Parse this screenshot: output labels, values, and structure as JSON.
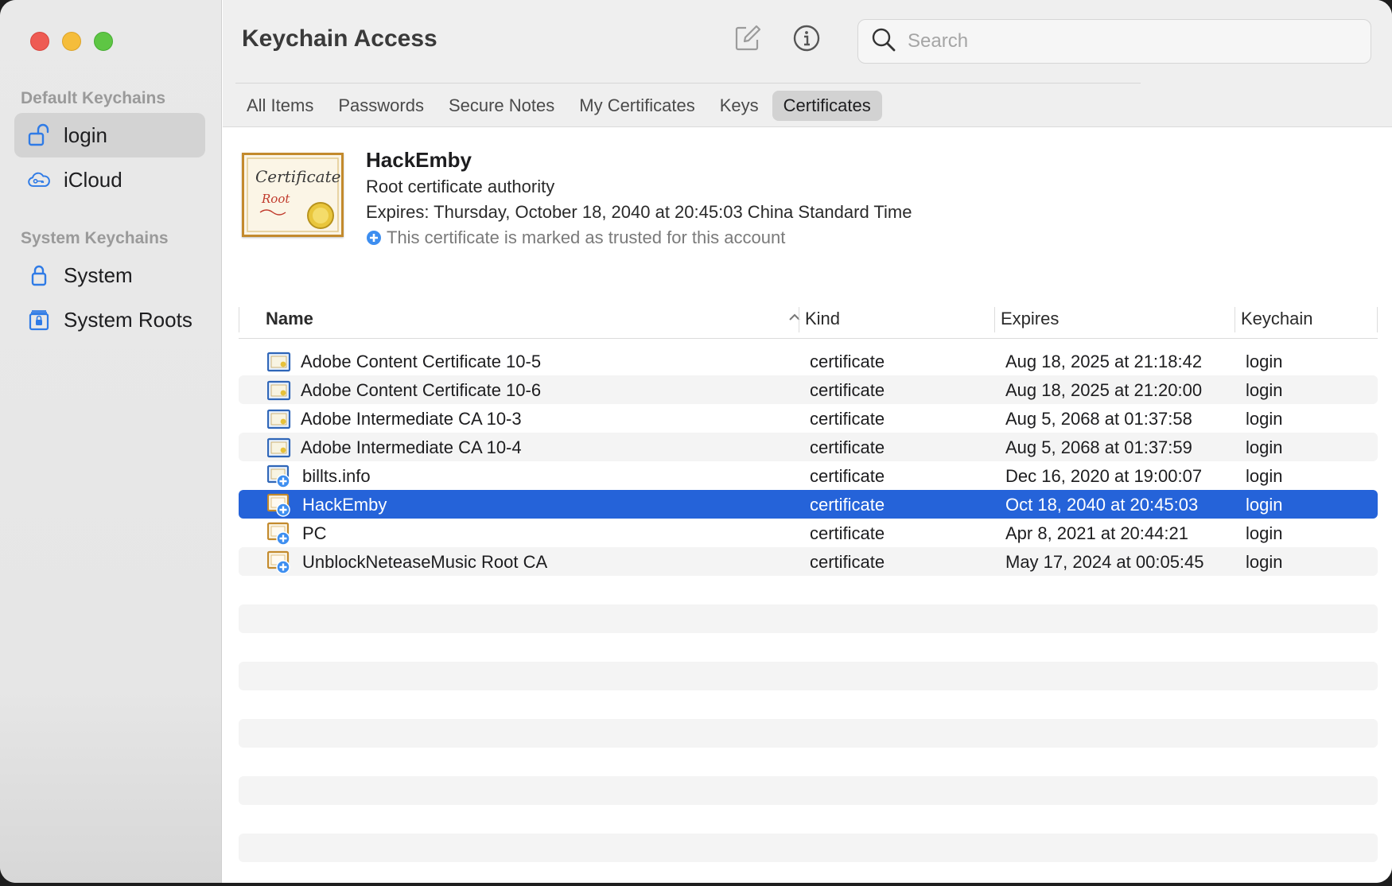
{
  "window": {
    "title": "Keychain Access"
  },
  "sidebar": {
    "default_header": "Default Keychains",
    "system_header": "System Keychains",
    "items": [
      {
        "label": "login",
        "icon": "unlocked-padlock-icon",
        "selected": true
      },
      {
        "label": "iCloud",
        "icon": "icloud-key-icon",
        "selected": false
      },
      {
        "label": "System",
        "icon": "padlock-icon",
        "selected": false
      },
      {
        "label": "System Roots",
        "icon": "cabinet-lock-icon",
        "selected": false
      }
    ]
  },
  "toolbar": {
    "compose_icon": "compose-icon",
    "info_icon": "info-icon"
  },
  "search": {
    "placeholder": "Search",
    "value": ""
  },
  "tabs": [
    {
      "label": "All Items",
      "active": false
    },
    {
      "label": "Passwords",
      "active": false
    },
    {
      "label": "Secure Notes",
      "active": false
    },
    {
      "label": "My Certificates",
      "active": false
    },
    {
      "label": "Keys",
      "active": false
    },
    {
      "label": "Certificates",
      "active": true
    }
  ],
  "detail": {
    "name": "HackEmby",
    "kind": "Root certificate authority",
    "expires": "Expires: Thursday, October 18, 2040 at 20:45:03 China Standard Time",
    "trust": "This certificate is marked as trusted for this account",
    "art_text_1": "Certificate",
    "art_text_2": "Root"
  },
  "table": {
    "columns": {
      "name": "Name",
      "kind": "Kind",
      "expires": "Expires",
      "keychain": "Keychain"
    },
    "rows": [
      {
        "name": "Adobe Content Certificate 10-5",
        "kind": "certificate",
        "expires": "Aug 18, 2025 at 21:18:42",
        "keychain": "login",
        "icon": "intermediate-cert-icon",
        "selected": false
      },
      {
        "name": "Adobe Content Certificate 10-6",
        "kind": "certificate",
        "expires": "Aug 18, 2025 at 21:20:00",
        "keychain": "login",
        "icon": "intermediate-cert-icon",
        "selected": false
      },
      {
        "name": "Adobe Intermediate CA 10-3",
        "kind": "certificate",
        "expires": "Aug 5, 2068 at 01:37:58",
        "keychain": "login",
        "icon": "intermediate-cert-icon",
        "selected": false
      },
      {
        "name": "Adobe Intermediate CA 10-4",
        "kind": "certificate",
        "expires": "Aug 5, 2068 at 01:37:59",
        "keychain": "login",
        "icon": "intermediate-cert-icon",
        "selected": false
      },
      {
        "name": "billts.info",
        "kind": "certificate",
        "expires": "Dec 16, 2020 at 19:00:07",
        "keychain": "login",
        "icon": "trusted-cert-icon",
        "selected": false
      },
      {
        "name": "HackEmby",
        "kind": "certificate",
        "expires": "Oct 18, 2040 at 20:45:03",
        "keychain": "login",
        "icon": "trusted-root-cert-icon",
        "selected": true
      },
      {
        "name": "PC",
        "kind": "certificate",
        "expires": "Apr 8, 2021 at 20:44:21",
        "keychain": "login",
        "icon": "trusted-root-cert-icon",
        "selected": false
      },
      {
        "name": "UnblockNeteaseMusic Root CA",
        "kind": "certificate",
        "expires": "May 17, 2024 at 00:05:45",
        "keychain": "login",
        "icon": "trusted-root-cert-icon",
        "selected": false
      }
    ]
  },
  "colors": {
    "selection": "#2563d9",
    "close": "#ee5b53",
    "minimize": "#f5bd3b",
    "zoom": "#5ec644",
    "accent_blue": "#3d8ef0"
  }
}
